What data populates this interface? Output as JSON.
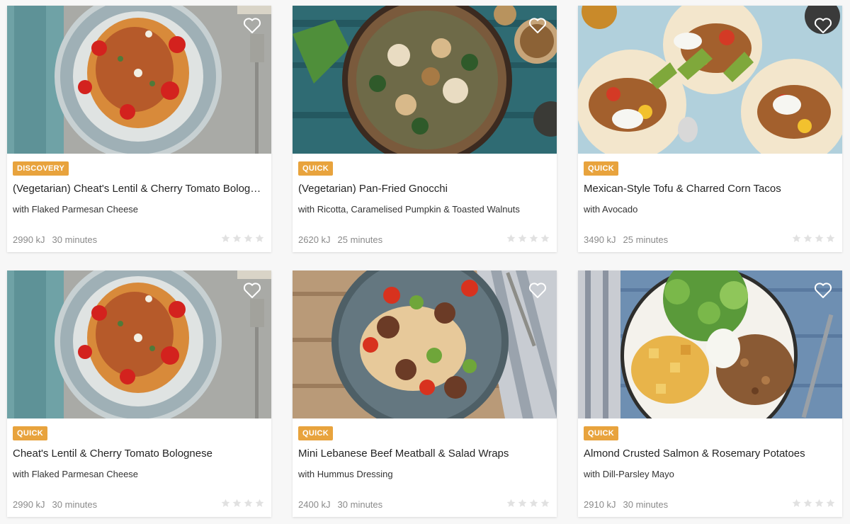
{
  "colors": {
    "badge": "#e8a33d",
    "card": "#ffffff",
    "page": "#f7f7f7",
    "star_empty": "#e1e1e1",
    "meta_text": "#8a8a8a"
  },
  "recipes": [
    {
      "badge": "DISCOVERY",
      "title": "(Vegetarian) Cheat's Lentil & Cherry Tomato Bolognese",
      "subtitle": "with Flaked Parmesan Cheese",
      "energy": "2990 kJ",
      "time": "30 minutes",
      "rating": 0,
      "image": "spaghetti-bolognese-photo"
    },
    {
      "badge": "QUICK",
      "title": "(Vegetarian) Pan-Fried Gnocchi",
      "subtitle": "with Ricotta, Caramelised Pumpkin & Toasted Walnuts",
      "energy": "2620 kJ",
      "time": "25 minutes",
      "rating": 0,
      "image": "gnocchi-bowl-photo"
    },
    {
      "badge": "QUICK",
      "title": "Mexican-Style Tofu & Charred Corn Tacos",
      "subtitle": "with Avocado",
      "energy": "3490 kJ",
      "time": "25 minutes",
      "rating": 0,
      "image": "tacos-photo"
    },
    {
      "badge": "QUICK",
      "title": "Cheat's Lentil & Cherry Tomato Bolognese",
      "subtitle": "with Flaked Parmesan Cheese",
      "energy": "2990 kJ",
      "time": "30 minutes",
      "rating": 0,
      "image": "spaghetti-bolognese-photo"
    },
    {
      "badge": "QUICK",
      "title": "Mini Lebanese Beef Meatball & Salad Wraps",
      "subtitle": "with Hummus Dressing",
      "energy": "2400 kJ",
      "time": "30 minutes",
      "rating": 0,
      "image": "meatball-wraps-photo"
    },
    {
      "badge": "QUICK",
      "title": "Almond Crusted Salmon & Rosemary Potatoes",
      "subtitle": "with Dill-Parsley Mayo",
      "energy": "2910 kJ",
      "time": "30 minutes",
      "rating": 0,
      "image": "salmon-potatoes-photo"
    }
  ]
}
